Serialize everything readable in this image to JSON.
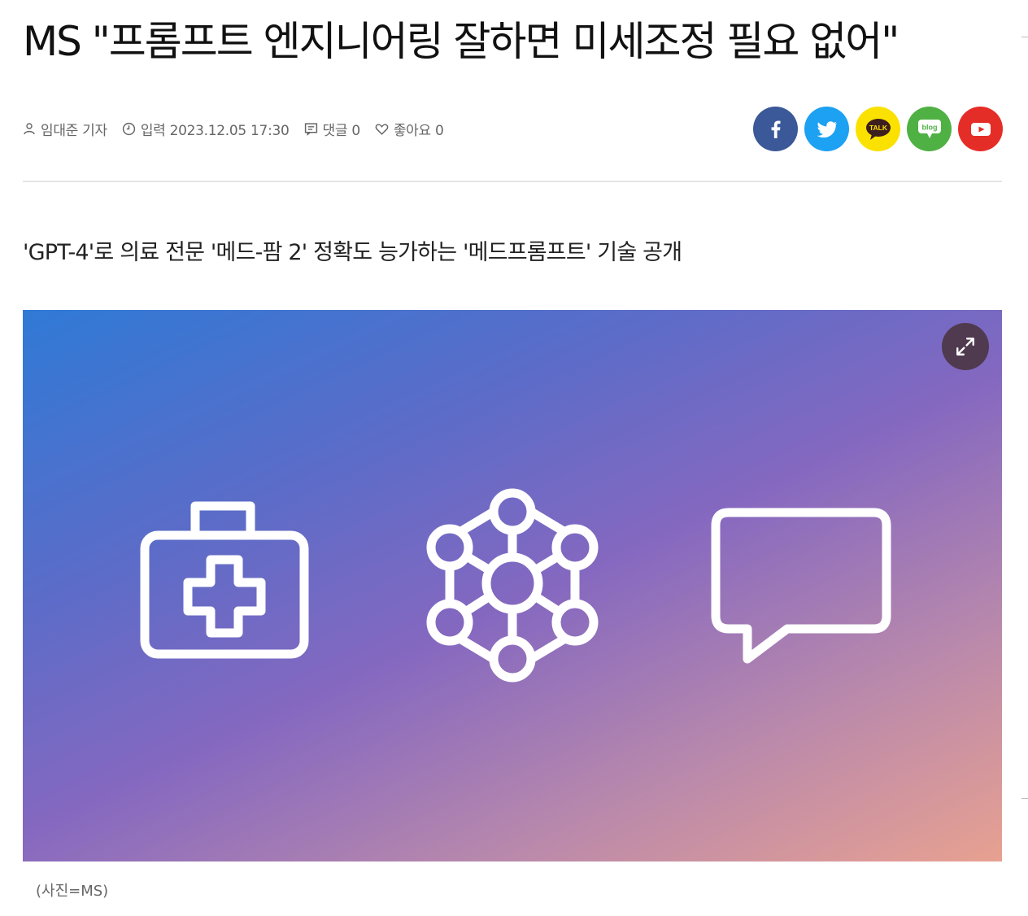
{
  "article": {
    "headline": "MS \"프롬프트 엔지니어링 잘하면 미세조정 필요 없어\"",
    "byline": {
      "reporter": "임대준 기자",
      "published": "입력 2023.12.05 17:30",
      "comments": "댓글 0",
      "likes": "좋아요 0"
    },
    "subtitle": "'GPT-4'로 의료 전문 '메드-팜 2' 정확도 능가하는 '메드프롬프트' 기술 공개",
    "image": {
      "caption": "(사진=MS)"
    }
  },
  "share": {
    "buttons": [
      {
        "name": "facebook",
        "icon": "facebook-icon",
        "color": "#3b5998"
      },
      {
        "name": "twitter",
        "icon": "twitter-icon",
        "color": "#1da1f2"
      },
      {
        "name": "kakaotalk",
        "icon": "kakaotalk-icon",
        "label": "TALK",
        "color": "#fae100"
      },
      {
        "name": "blog",
        "icon": "naver-blog-icon",
        "label": "blog",
        "color": "#4fb143"
      },
      {
        "name": "youtube",
        "icon": "youtube-icon",
        "color": "#e52d27"
      }
    ]
  }
}
